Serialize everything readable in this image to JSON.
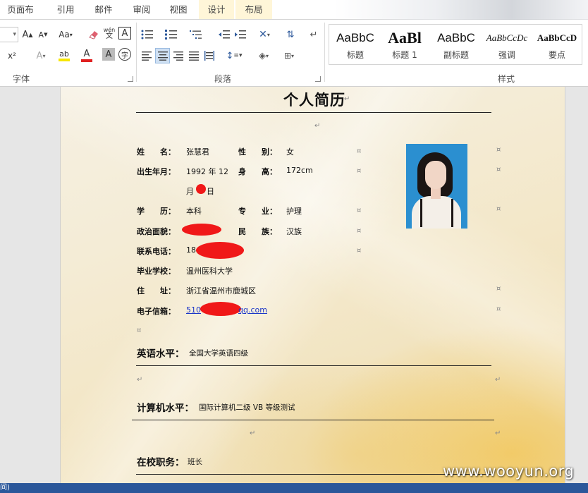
{
  "ribbon": {
    "tabs": [
      {
        "label": "页面布局"
      },
      {
        "label": "引用"
      },
      {
        "label": "邮件"
      },
      {
        "label": "审阅"
      },
      {
        "label": "视图"
      },
      {
        "label": "设计"
      },
      {
        "label": "布局"
      }
    ],
    "groups": {
      "font": "字体",
      "paragraph": "段落",
      "styles": "样式"
    },
    "font_buttons": {
      "grow": "A",
      "shrink": "A",
      "case": "Aa",
      "phonetic": "wén",
      "char_border": "A",
      "superscript": "x²",
      "text_effect": "A",
      "highlight": "ab",
      "font_color": "A",
      "char_shading": "A",
      "enclose": "字"
    },
    "styles_gallery": [
      {
        "sample": "AaBbC",
        "name": "标题"
      },
      {
        "sample": "AaBl",
        "name": "标题 1"
      },
      {
        "sample": "AaBbC",
        "name": "副标题"
      },
      {
        "sample": "AaBbCcDc",
        "name": "强调"
      },
      {
        "sample": "AaBbCcD",
        "name": "要点"
      }
    ],
    "accent_color": "#2b579a"
  },
  "document": {
    "title": "个人简历",
    "paragraph_mark": "↵",
    "cell_mark": "¤",
    "fields": {
      "name_label": "姓　　名：",
      "name_value": "张慧君",
      "gender_label": "性　　别：",
      "gender_value": "女",
      "birth_label": "出生年月：",
      "birth_value_1": "1992 年 12",
      "birth_value_2": "月",
      "birth_value_3": "日",
      "height_label": "身　　高：",
      "height_value": "172cm",
      "education_label": "学　　历：",
      "education_value": "本科",
      "major_label": "专　　业：",
      "major_value": "护理",
      "politics_label": "政治面貌：",
      "ethnicity_label": "民　　族：",
      "ethnicity_value": "汉族",
      "phone_label": "联系电话：",
      "phone_value": "18",
      "school_label": "毕业学校：",
      "school_value": "温州医科大学",
      "address_label": "住　　址：",
      "address_value": "浙江省温州市鹿城区",
      "email_label": "电子信箱：",
      "email_value": "510",
      "email_suffix": "qq.com"
    },
    "sections": {
      "english_label": "英语水平：",
      "english_value": "全国大学英语四级",
      "computer_label": "计算机水平：",
      "computer_value": "国际计算机二级 VB 等级测试",
      "campus_label": "在校职务：",
      "campus_value": "班长"
    },
    "redaction_color": "#f01818"
  },
  "watermark": "www.wooyun.org",
  "status": {
    "left_text": "间)"
  }
}
